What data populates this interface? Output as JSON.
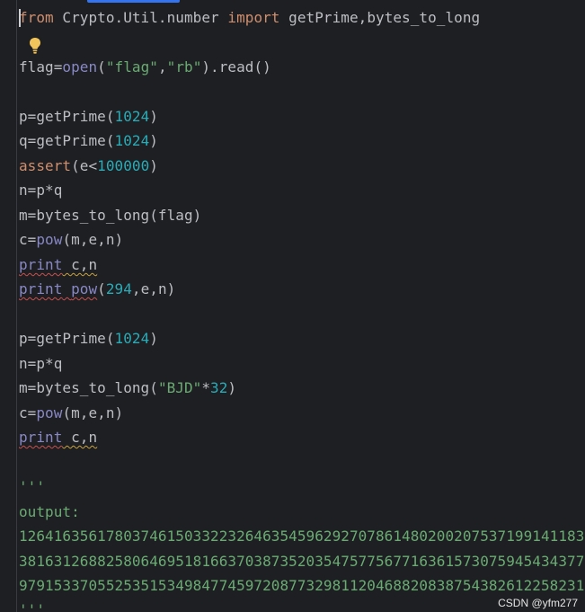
{
  "editor": {
    "language": "python",
    "lines": {
      "l1": {
        "kw1": "from",
        "mod": " Crypto.Util.number ",
        "kw2": "import",
        "names": " getPrime,bytes_to_long"
      },
      "l3": {
        "a": "flag=",
        "fn": "open",
        "b": "(",
        "s1": "\"flag\"",
        "c": ",",
        "s2": "\"rb\"",
        "d": ").read()"
      },
      "l5": {
        "a": "p=getPrime(",
        "n": "1024",
        "b": ")"
      },
      "l6": {
        "a": "q=getPrime(",
        "n": "1024",
        "b": ")"
      },
      "l7": {
        "kw": "assert",
        "a": "(e<",
        "n": "100000",
        "b": ")"
      },
      "l8": {
        "a": "n=p*q"
      },
      "l9": {
        "a": "m=bytes_to_long(flag)"
      },
      "l10": {
        "a": "c=",
        "fn": "pow",
        "b": "(m,e,n)"
      },
      "l11": {
        "kw": "print",
        "a": " c,n"
      },
      "l12": {
        "kw": "print",
        "sp": " ",
        "fn": "pow",
        "a": "(",
        "n": "294",
        "b": ",e,n)"
      },
      "l14": {
        "a": "p=getPrime(",
        "n": "1024",
        "b": ")"
      },
      "l15": {
        "a": "n=p*q"
      },
      "l16": {
        "a": "m=bytes_to_long(",
        "s": "\"BJD\"",
        "b": "*",
        "n": "32",
        "c": ")"
      },
      "l17": {
        "a": "c=",
        "fn": "pow",
        "b": "(m,e,n)"
      },
      "l18": {
        "kw": "print",
        "a": " c,n"
      },
      "l20": {
        "a": "'''"
      },
      "l21": {
        "a": "output:"
      },
      "l22": {
        "a": "12641635617803746150332232646354596292707861480200207537199141183"
      },
      "l23": {
        "a": "38163126882580646951816637038735203547577567716361573075945434377"
      },
      "l24": {
        "a": "97915337055253515349847745972087732981120468820838754382612258231"
      },
      "l25": {
        "a": "'''"
      }
    },
    "colors": {
      "background": "#1e1f22",
      "keyword": "#cf8e6d",
      "string": "#6aab73",
      "number": "#2aacb8",
      "builtin": "#8888c6",
      "text": "#bcbec4"
    }
  },
  "icons": {
    "intention": "lightbulb-icon"
  },
  "watermark": "CSDN @yfm277"
}
